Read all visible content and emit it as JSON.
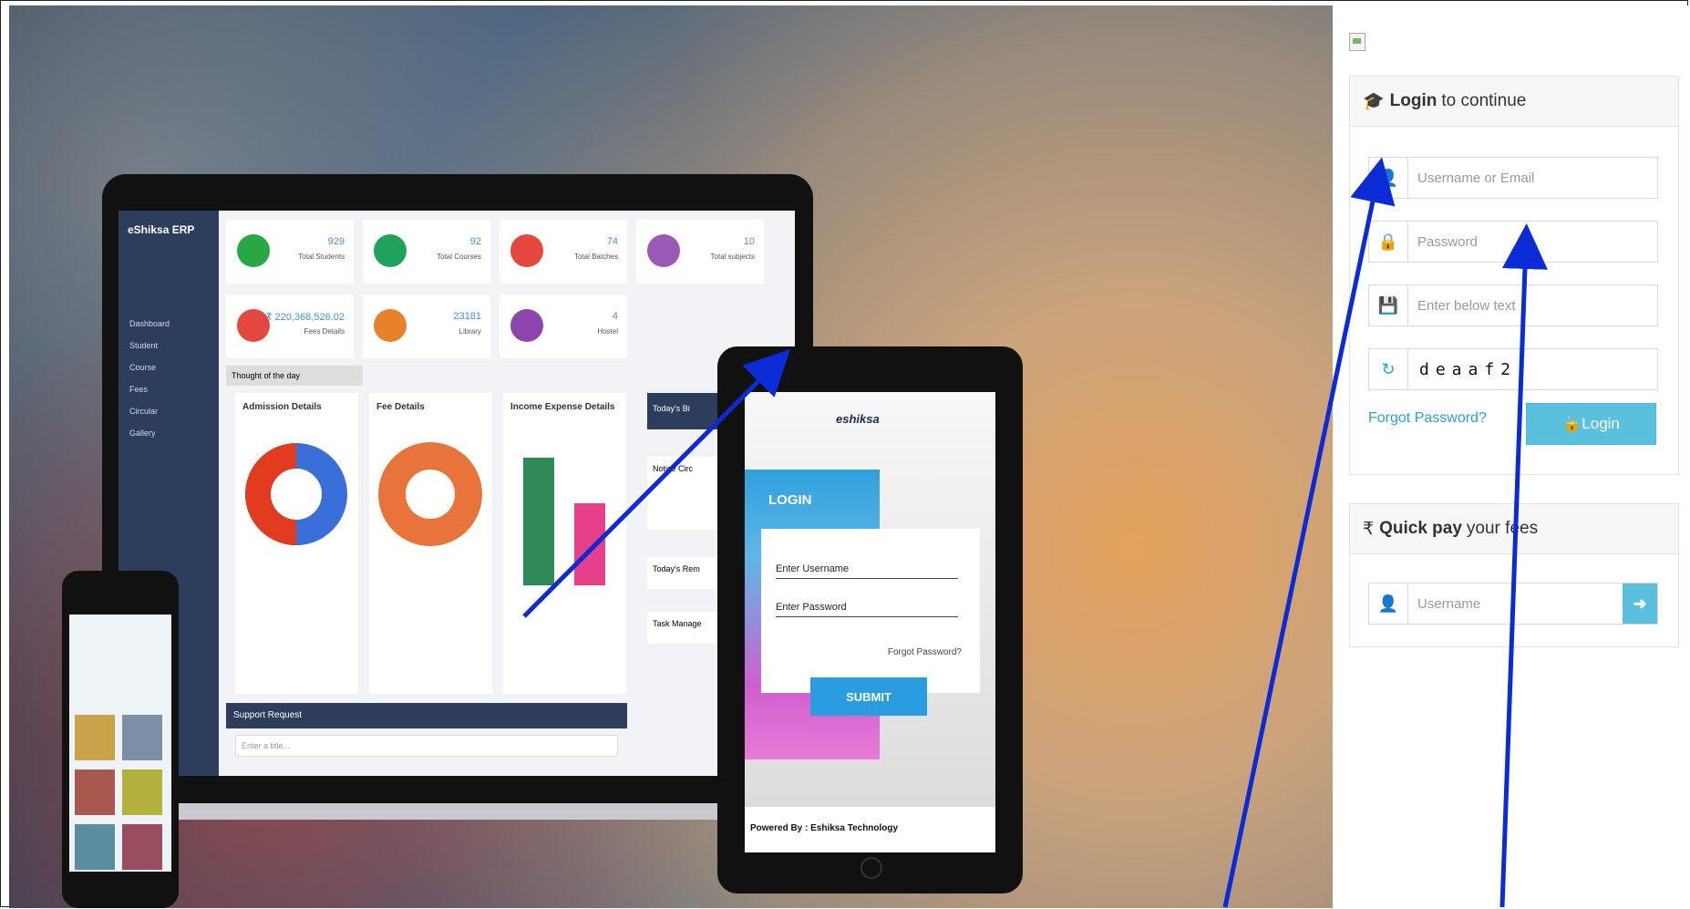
{
  "login_box": {
    "title_bold": "Login",
    "title_rest": "to continue",
    "username_placeholder": "Username or Email",
    "password_placeholder": "Password",
    "captcha_placeholder": "Enter below text",
    "captcha_text": "deaaf2",
    "forgot_label": "Forgot Password?",
    "login_label": "Login"
  },
  "quick_pay": {
    "title_bold": "Quick pay",
    "title_rest": "your fees",
    "username_placeholder": "Username"
  },
  "laptop": {
    "brand": "eShiksa ERP",
    "menu": [
      "Dashboard",
      "Student",
      "Course",
      "Fees",
      "Circular",
      "Gallery"
    ],
    "cards": [
      {
        "value": "929",
        "label": "Total Students",
        "color": "#27a844"
      },
      {
        "value": "92",
        "label": "Total Courses",
        "color": "#1fa35b"
      },
      {
        "value": "74",
        "label": "Total Batches",
        "color": "#e3473d"
      },
      {
        "value": "10",
        "label": "Total subjects",
        "color": "#9b59b6"
      },
      {
        "value": "₹ 220,368,526.02",
        "label": "Fees Details",
        "color": "#e3473d"
      },
      {
        "value": "23181",
        "label": "Library",
        "color": "#e8822a"
      },
      {
        "value": "4",
        "label": "Hostel",
        "color": "#8e44ad"
      }
    ],
    "thought": "Thought of the day",
    "panels": [
      "Admission Details",
      "Fee Details",
      "Income Expense Details"
    ],
    "side_panels": [
      "Today's Bi",
      "Notice Circ",
      "Today's Rem",
      "Task Manage"
    ],
    "support": "Support Request",
    "support_placeholder": "Enter a title..."
  },
  "tablet": {
    "logo": "eshiksa",
    "login_title": "LOGIN",
    "username": "Enter Username",
    "password": "Enter Password",
    "forgot": "Forgot Password?",
    "submit": "SUBMIT",
    "footer": "Powered By : Eshiksa Technology"
  },
  "icons": {
    "graduation": "graduation-cap-icon",
    "user": "user-icon",
    "lock": "lock-icon",
    "captcha": "captcha-icon",
    "refresh": "refresh-icon",
    "unlock": "unlock-icon",
    "rupee": "rupee-icon",
    "arrow": "arrow-right-icon"
  },
  "colors": {
    "accent": "#2b9fd6",
    "button": "#5bc0de",
    "annotation_arrow": "#0a2bd6"
  }
}
